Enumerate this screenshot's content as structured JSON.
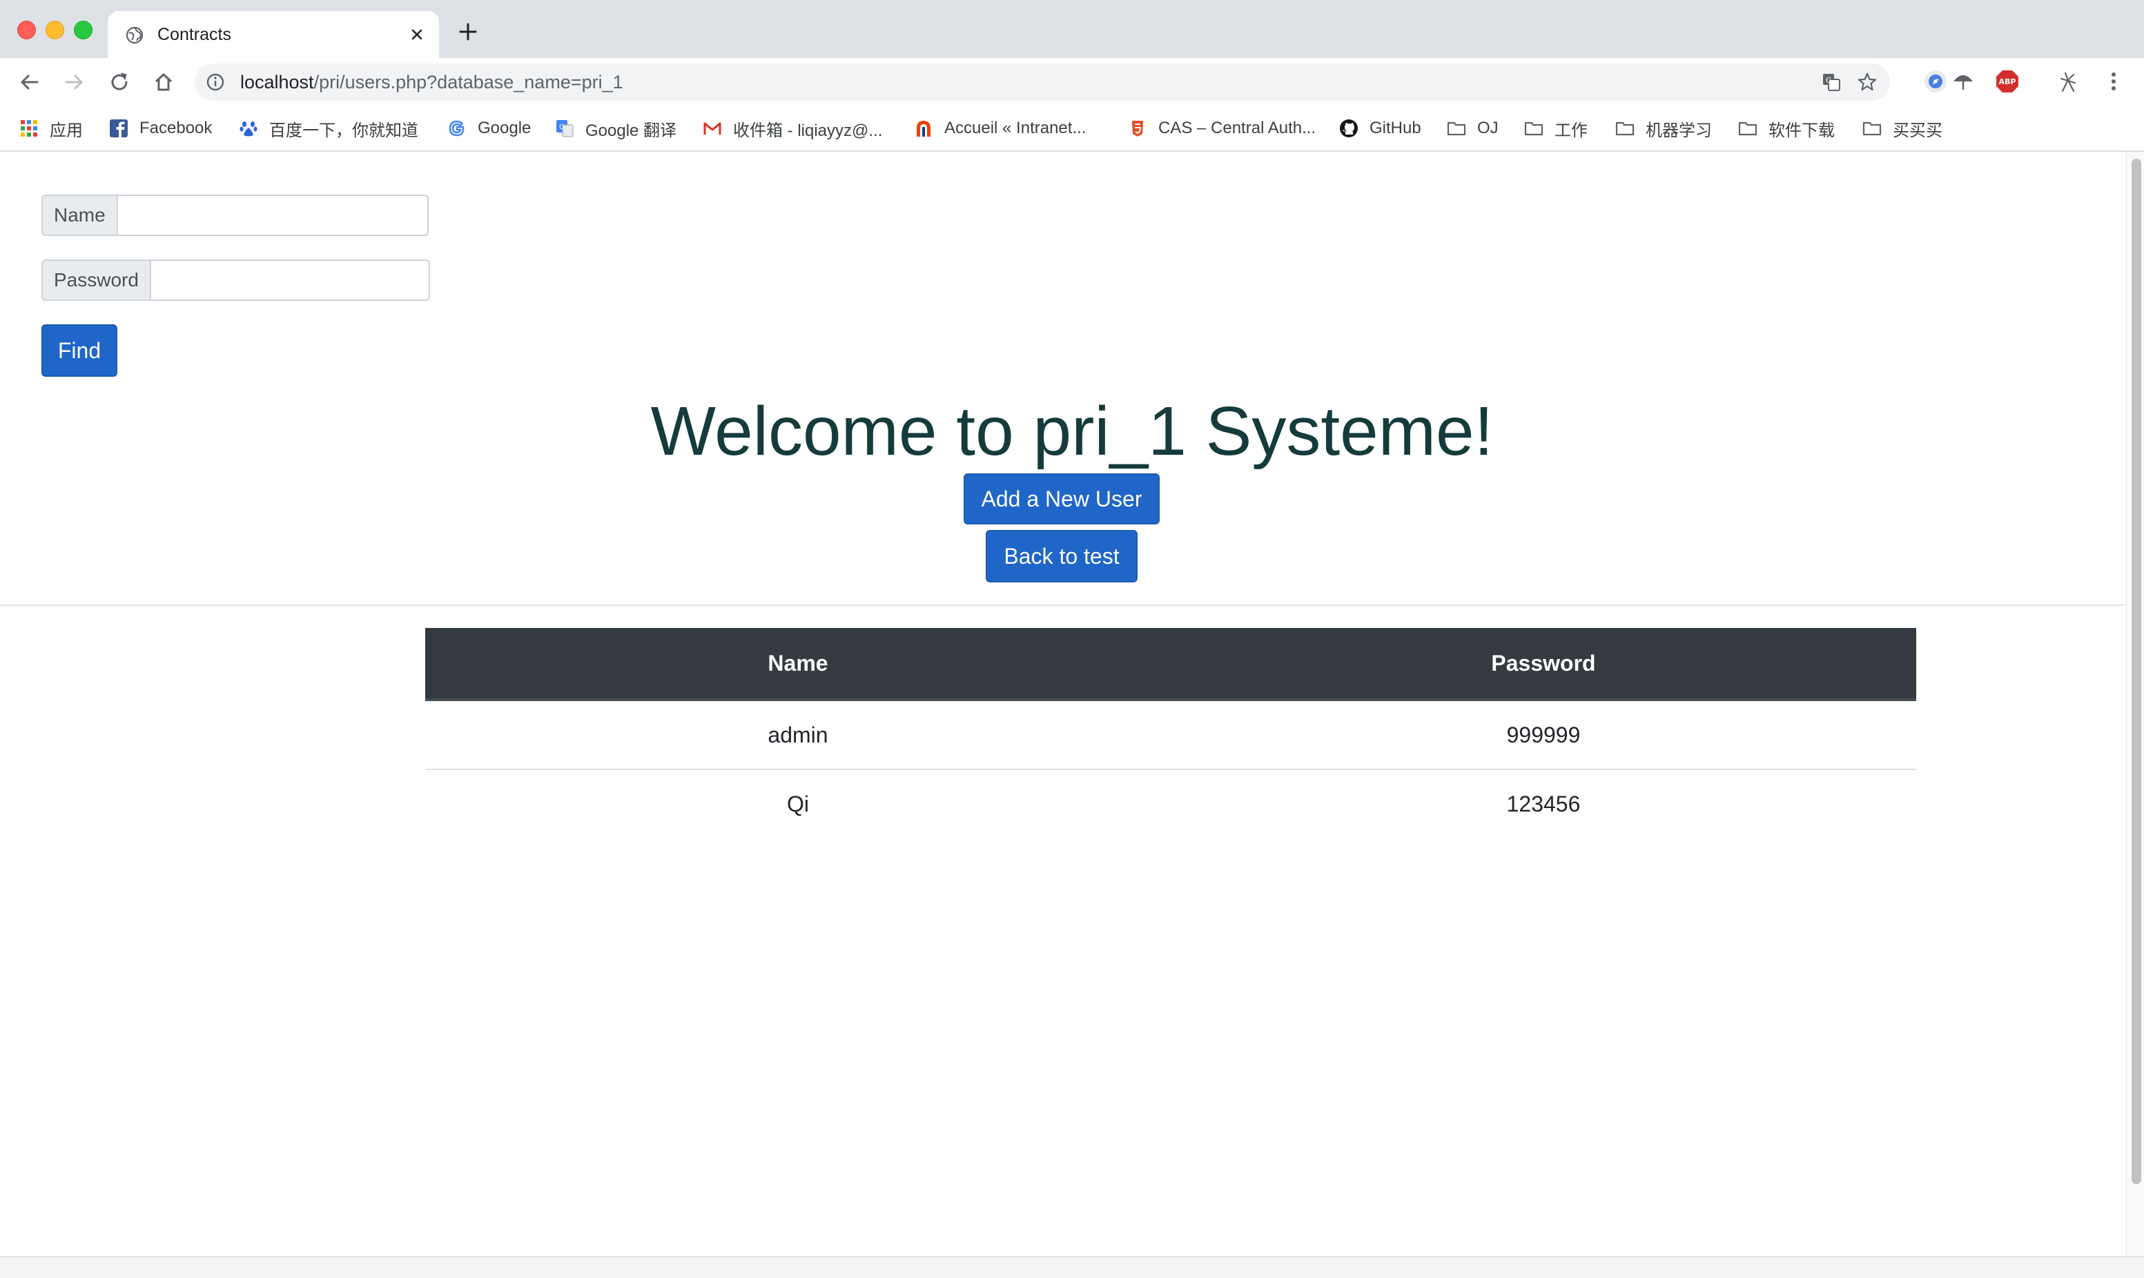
{
  "browser": {
    "tab_title": "Contracts",
    "url_host": "localhost",
    "url_path": "/pri/users.php?database_name=pri_1",
    "bookmarks": [
      {
        "label": "应用",
        "icon": "apps-grid-icon"
      },
      {
        "label": "Facebook",
        "icon": "facebook-icon"
      },
      {
        "label": "百度一下，你就知道",
        "icon": "baidu-paw-icon"
      },
      {
        "label": "Google",
        "icon": "google-icon"
      },
      {
        "label": "Google 翻译",
        "icon": "google-translate-icon"
      },
      {
        "label": "收件箱 - liqiayyz@...",
        "icon": "gmail-icon"
      },
      {
        "label": "Accueil « Intranet...",
        "icon": "intranet-icon"
      },
      {
        "label": "CAS – Central Auth...",
        "icon": "cas-shield-icon"
      },
      {
        "label": "GitHub",
        "icon": "github-icon"
      },
      {
        "label": "OJ",
        "icon": "folder-icon"
      },
      {
        "label": "工作",
        "icon": "folder-icon"
      },
      {
        "label": "机器学习",
        "icon": "folder-icon"
      },
      {
        "label": "软件下载",
        "icon": "folder-icon"
      },
      {
        "label": "买买买",
        "icon": "folder-icon"
      }
    ]
  },
  "search_form": {
    "name_label": "Name",
    "name_value": "",
    "password_label": "Password",
    "password_value": "",
    "find_label": "Find"
  },
  "main": {
    "title": "Welcome to pri_1 Systeme!",
    "add_user_label": "Add a New User",
    "back_label": "Back to test"
  },
  "table": {
    "columns": [
      "Name",
      "Password"
    ],
    "rows": [
      [
        "admin",
        "999999"
      ],
      [
        "Qi",
        "123456"
      ]
    ]
  },
  "colors": {
    "primary_button": "#2066c9",
    "table_header": "#343a40",
    "title_text": "#153b3b"
  }
}
